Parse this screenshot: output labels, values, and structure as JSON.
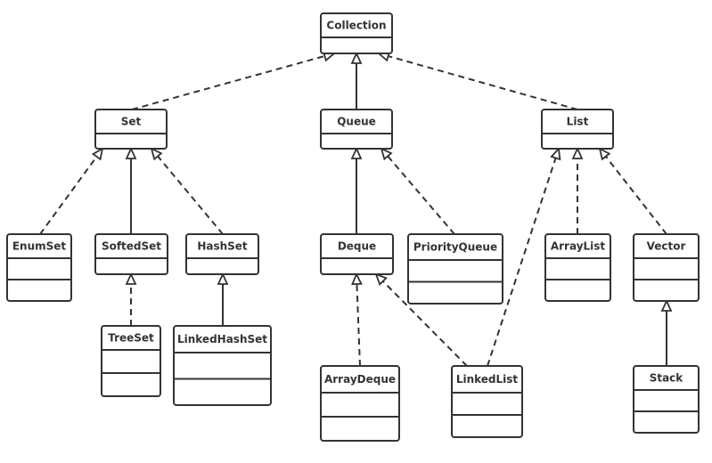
{
  "diagram": {
    "type": "uml-class-hierarchy",
    "line_color": "#333333",
    "classes": [
      {
        "id": "collection",
        "name": "Collection",
        "compartments": 1
      },
      {
        "id": "set",
        "name": "Set",
        "compartments": 1
      },
      {
        "id": "queue",
        "name": "Queue",
        "compartments": 1
      },
      {
        "id": "list",
        "name": "List",
        "compartments": 1
      },
      {
        "id": "enumset",
        "name": "EnumSet",
        "compartments": 2
      },
      {
        "id": "softedset",
        "name": "SoftedSet",
        "compartments": 1
      },
      {
        "id": "hashset",
        "name": "HashSet",
        "compartments": 1
      },
      {
        "id": "deque",
        "name": "Deque",
        "compartments": 1
      },
      {
        "id": "priorityqueue",
        "name": "PriorityQueue",
        "compartments": 2
      },
      {
        "id": "arraylist",
        "name": "ArrayList",
        "compartments": 2
      },
      {
        "id": "vector",
        "name": "Vector",
        "compartments": 2
      },
      {
        "id": "treeset",
        "name": "TreeSet",
        "compartments": 2
      },
      {
        "id": "linkedhashset",
        "name": "LinkedHashSet",
        "compartments": 2
      },
      {
        "id": "arraydeque",
        "name": "ArrayDeque",
        "compartments": 2
      },
      {
        "id": "linkedlist",
        "name": "LinkedList",
        "compartments": 2
      },
      {
        "id": "stack",
        "name": "Stack",
        "compartments": 2
      }
    ],
    "relations": [
      {
        "from": "set",
        "to": "collection",
        "style": "dashed"
      },
      {
        "from": "queue",
        "to": "collection",
        "style": "solid"
      },
      {
        "from": "list",
        "to": "collection",
        "style": "dashed"
      },
      {
        "from": "enumset",
        "to": "set",
        "style": "dashed"
      },
      {
        "from": "softedset",
        "to": "set",
        "style": "solid"
      },
      {
        "from": "hashset",
        "to": "set",
        "style": "dashed"
      },
      {
        "from": "treeset",
        "to": "softedset",
        "style": "dashed"
      },
      {
        "from": "linkedhashset",
        "to": "hashset",
        "style": "solid"
      },
      {
        "from": "deque",
        "to": "queue",
        "style": "solid"
      },
      {
        "from": "priorityqueue",
        "to": "queue",
        "style": "dashed"
      },
      {
        "from": "linkedlist",
        "to": "list",
        "style": "dashed"
      },
      {
        "from": "arraylist",
        "to": "list",
        "style": "dashed"
      },
      {
        "from": "vector",
        "to": "list",
        "style": "dashed"
      },
      {
        "from": "arraydeque",
        "to": "deque",
        "style": "dashed"
      },
      {
        "from": "linkedlist",
        "to": "deque",
        "style": "dashed"
      },
      {
        "from": "stack",
        "to": "vector",
        "style": "solid"
      }
    ]
  }
}
